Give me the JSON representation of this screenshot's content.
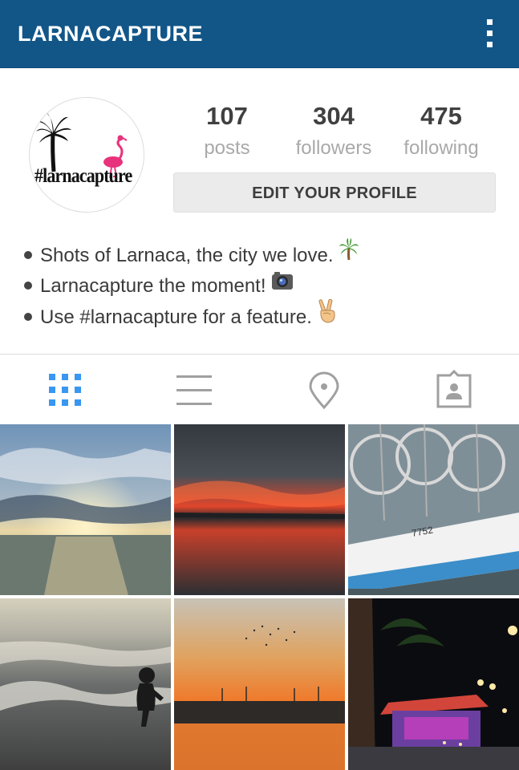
{
  "app_bar": {
    "title": "LARNACAPTURE",
    "menu_icon": "more-vertical-icon",
    "background_color": "#125688"
  },
  "profile": {
    "avatar_logo_text": "#larnacapture",
    "stats": [
      {
        "number": "107",
        "label": "posts"
      },
      {
        "number": "304",
        "label": "followers"
      },
      {
        "number": "475",
        "label": "following"
      }
    ],
    "edit_button_label": "EDIT YOUR PROFILE"
  },
  "bio": {
    "lines": [
      {
        "text": "Shots of Larnaca, the city we love.",
        "emoji": "palm-tree-icon"
      },
      {
        "text": "Larnacapture the moment!",
        "emoji": "camera-icon"
      },
      {
        "text": "Use #larnacapture for a feature.",
        "emoji": "victory-hand-icon"
      }
    ]
  },
  "tabs": [
    {
      "name": "grid-view",
      "icon": "grid-icon",
      "active": true
    },
    {
      "name": "list-view",
      "icon": "list-icon",
      "active": false
    },
    {
      "name": "photo-map",
      "icon": "location-pin-icon",
      "active": false
    },
    {
      "name": "tagged-photos",
      "icon": "person-tag-icon",
      "active": false
    }
  ],
  "colors": {
    "accent": "#3897f0",
    "inactive_icon": "#a0a0a0"
  },
  "photos": [
    {
      "subject": "sunset over sea with clouds"
    },
    {
      "subject": "red sunset reflected on salt lake"
    },
    {
      "subject": "fishing boats in marina"
    },
    {
      "subject": "child silhouette at beach shore"
    },
    {
      "subject": "orange sunset with wind turbines"
    },
    {
      "subject": "illuminated kiosk on palm promenade at night"
    }
  ]
}
